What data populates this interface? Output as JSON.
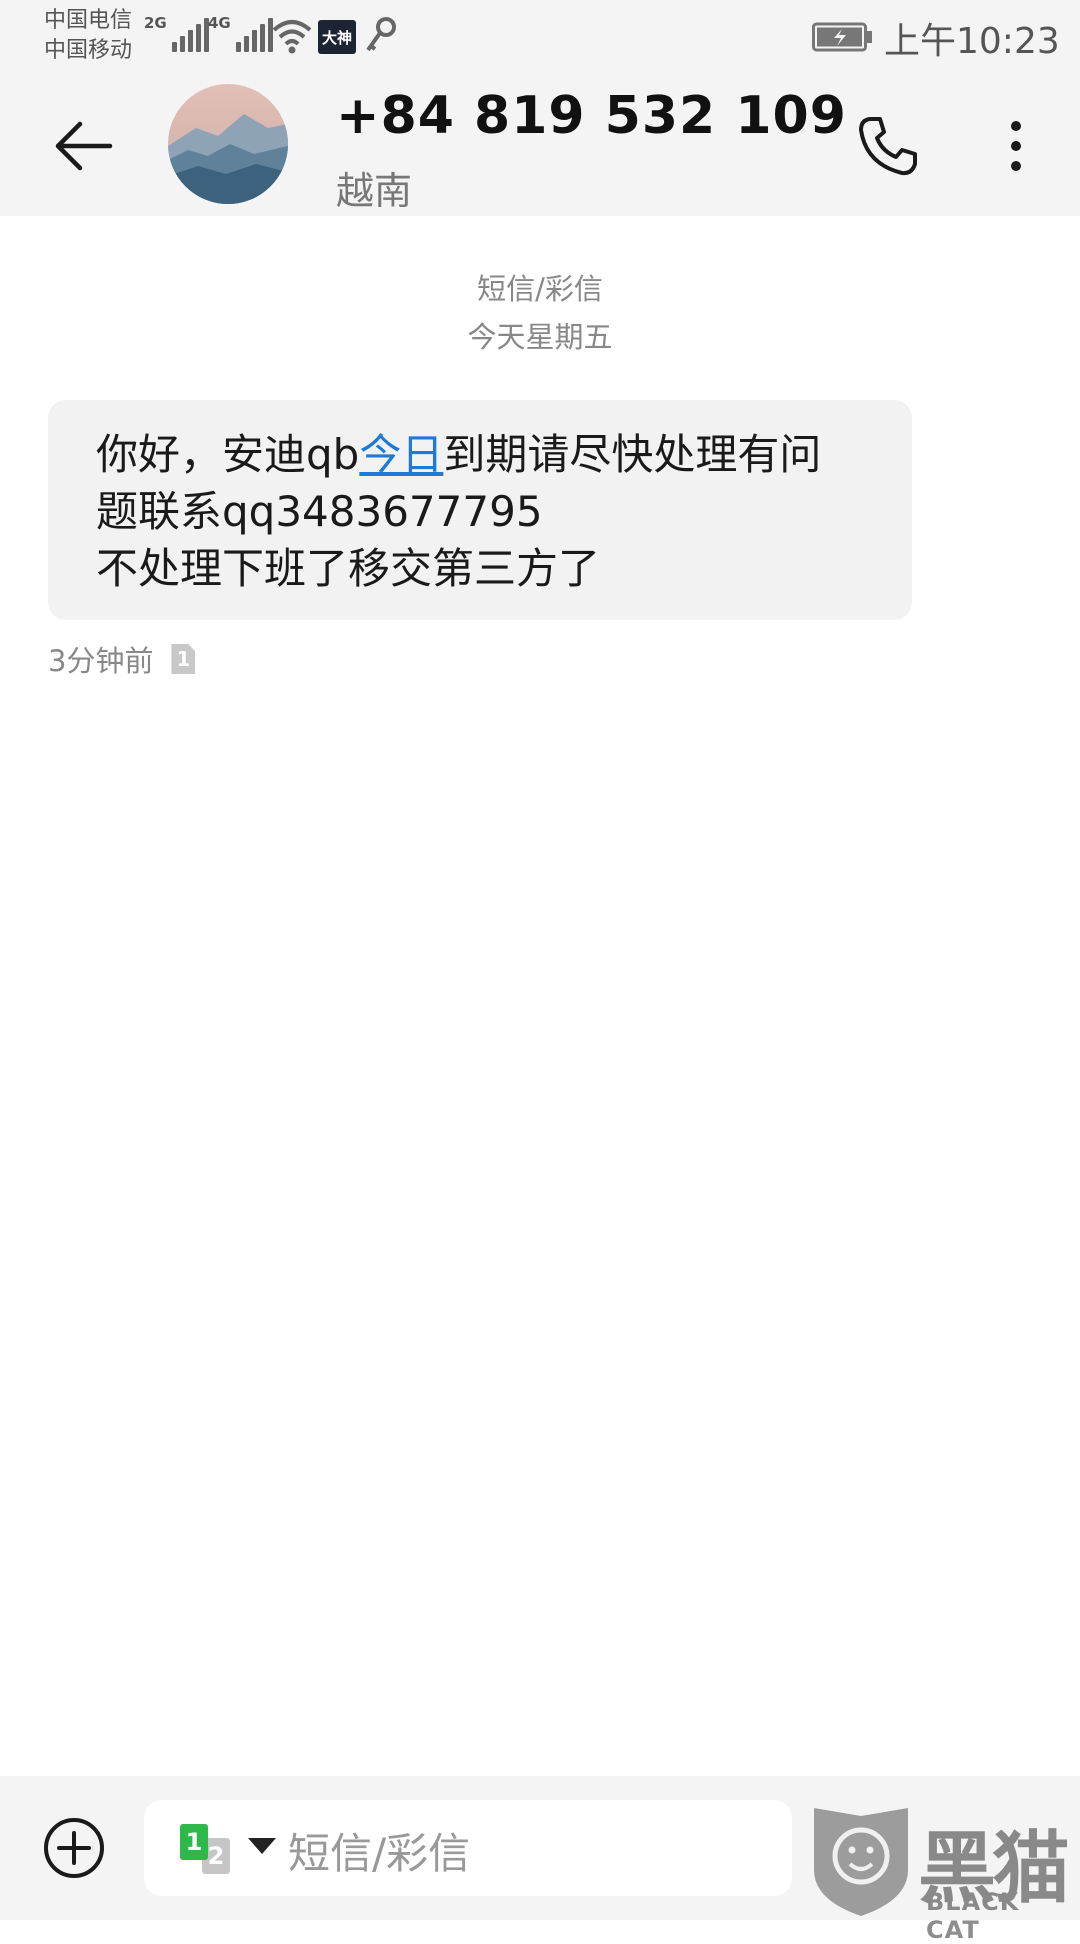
{
  "status_bar": {
    "carrier_1": "中国电信",
    "carrier_2": "中国移动",
    "net_1": "2G",
    "net_2": "4G",
    "app_badge": "大神",
    "time": "上午10:23"
  },
  "header": {
    "contact_number": "+84 819 532 109",
    "contact_region": "越南"
  },
  "conversation": {
    "channel_label": "短信/彩信",
    "date_label": "今天星期五",
    "messages": [
      {
        "text_before_link": "你好，安迪qb",
        "link_text": "今日",
        "text_after_link": "到期请尽快处理有问",
        "line_2": "题联系qq3483677795",
        "line_3": "不处理下班了移交第三方了",
        "timestamp": "3分钟前",
        "sim_slot": "1"
      }
    ]
  },
  "composer": {
    "sim_1": "1",
    "sim_2": "2",
    "placeholder": "短信/彩信"
  },
  "watermark": {
    "text_cn": "黑猫",
    "text_en": "BLACK CAT"
  },
  "icons": {
    "back": "arrow-left-icon",
    "call": "phone-icon",
    "more": "more-vertical-icon",
    "attach": "plus-circle-icon",
    "wifi": "wifi-icon",
    "key": "key-icon",
    "battery": "battery-charging-icon"
  }
}
